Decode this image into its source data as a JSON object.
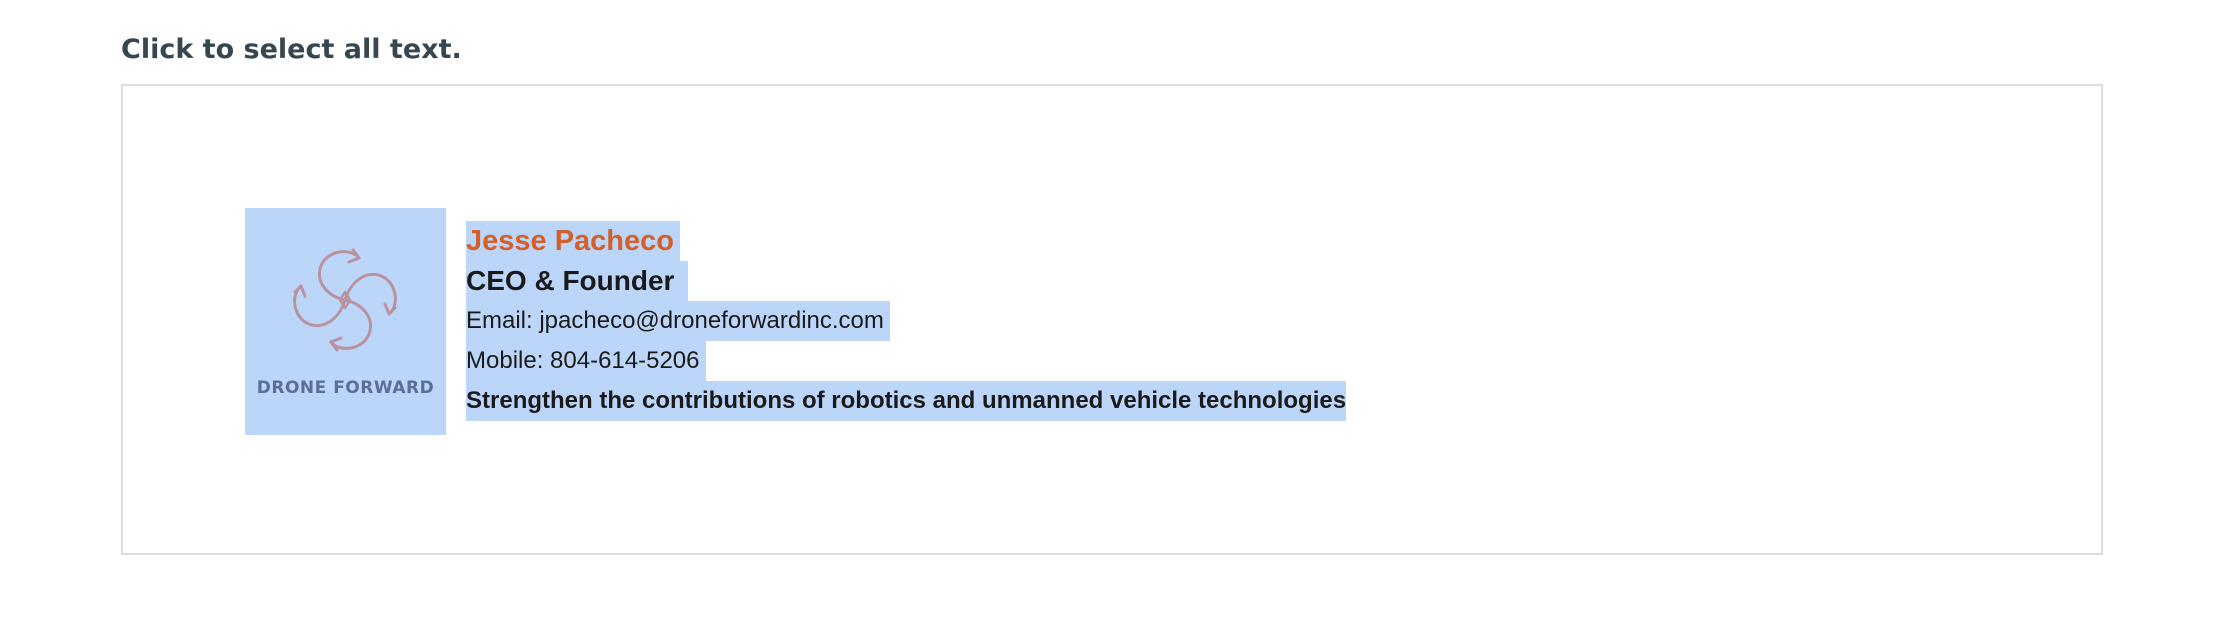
{
  "instruction": "Click to select all text.",
  "signature": {
    "logo_text": "DRONE FORWARD",
    "logo_icon": "drone-arrows-icon",
    "name": "Jesse Pacheco",
    "role": "CEO & Founder",
    "email": "Email: jpacheco@droneforwardinc.com",
    "mobile": "Mobile: 804-614-5206",
    "tagline": "Strengthen the contributions of robotics and unmanned vehicle technologies"
  },
  "colors": {
    "selection_highlight": "#bcd6fa",
    "name_accent": "#d35f2b",
    "logo_stroke": "#b8929f",
    "logo_text": "#5a6f93",
    "instruction_text": "#37474f"
  }
}
